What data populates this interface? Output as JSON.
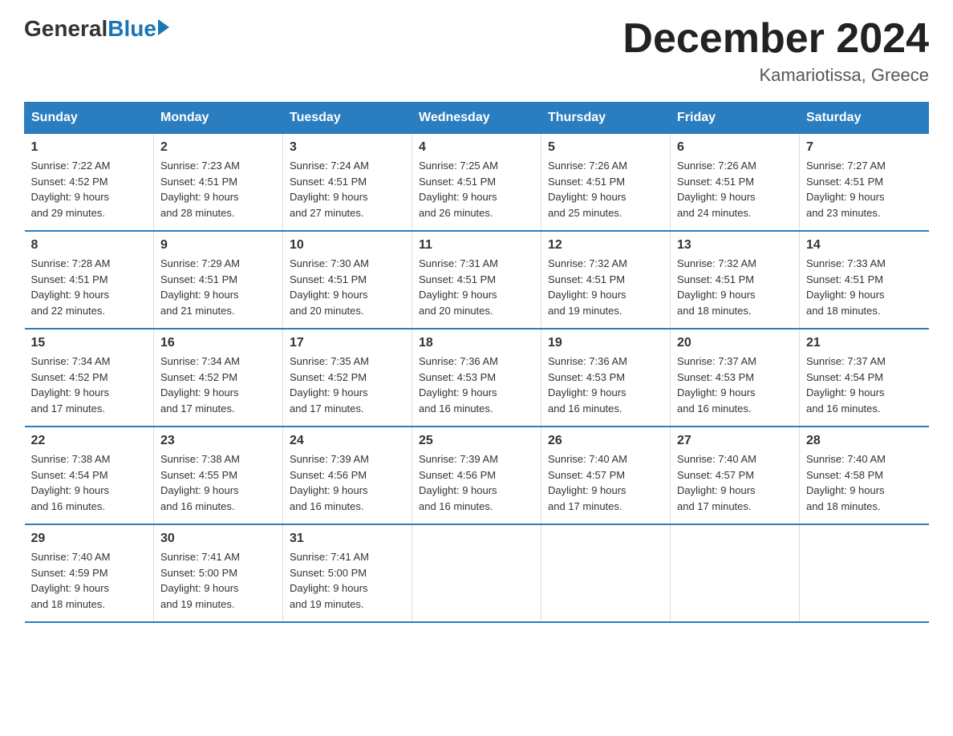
{
  "logo": {
    "general": "General",
    "blue": "Blue"
  },
  "title": "December 2024",
  "location": "Kamariotissa, Greece",
  "days_of_week": [
    "Sunday",
    "Monday",
    "Tuesday",
    "Wednesday",
    "Thursday",
    "Friday",
    "Saturday"
  ],
  "weeks": [
    [
      {
        "day": "1",
        "sunrise": "7:22 AM",
        "sunset": "4:52 PM",
        "daylight": "9 hours and 29 minutes."
      },
      {
        "day": "2",
        "sunrise": "7:23 AM",
        "sunset": "4:51 PM",
        "daylight": "9 hours and 28 minutes."
      },
      {
        "day": "3",
        "sunrise": "7:24 AM",
        "sunset": "4:51 PM",
        "daylight": "9 hours and 27 minutes."
      },
      {
        "day": "4",
        "sunrise": "7:25 AM",
        "sunset": "4:51 PM",
        "daylight": "9 hours and 26 minutes."
      },
      {
        "day": "5",
        "sunrise": "7:26 AM",
        "sunset": "4:51 PM",
        "daylight": "9 hours and 25 minutes."
      },
      {
        "day": "6",
        "sunrise": "7:26 AM",
        "sunset": "4:51 PM",
        "daylight": "9 hours and 24 minutes."
      },
      {
        "day": "7",
        "sunrise": "7:27 AM",
        "sunset": "4:51 PM",
        "daylight": "9 hours and 23 minutes."
      }
    ],
    [
      {
        "day": "8",
        "sunrise": "7:28 AM",
        "sunset": "4:51 PM",
        "daylight": "9 hours and 22 minutes."
      },
      {
        "day": "9",
        "sunrise": "7:29 AM",
        "sunset": "4:51 PM",
        "daylight": "9 hours and 21 minutes."
      },
      {
        "day": "10",
        "sunrise": "7:30 AM",
        "sunset": "4:51 PM",
        "daylight": "9 hours and 20 minutes."
      },
      {
        "day": "11",
        "sunrise": "7:31 AM",
        "sunset": "4:51 PM",
        "daylight": "9 hours and 20 minutes."
      },
      {
        "day": "12",
        "sunrise": "7:32 AM",
        "sunset": "4:51 PM",
        "daylight": "9 hours and 19 minutes."
      },
      {
        "day": "13",
        "sunrise": "7:32 AM",
        "sunset": "4:51 PM",
        "daylight": "9 hours and 18 minutes."
      },
      {
        "day": "14",
        "sunrise": "7:33 AM",
        "sunset": "4:51 PM",
        "daylight": "9 hours and 18 minutes."
      }
    ],
    [
      {
        "day": "15",
        "sunrise": "7:34 AM",
        "sunset": "4:52 PM",
        "daylight": "9 hours and 17 minutes."
      },
      {
        "day": "16",
        "sunrise": "7:34 AM",
        "sunset": "4:52 PM",
        "daylight": "9 hours and 17 minutes."
      },
      {
        "day": "17",
        "sunrise": "7:35 AM",
        "sunset": "4:52 PM",
        "daylight": "9 hours and 17 minutes."
      },
      {
        "day": "18",
        "sunrise": "7:36 AM",
        "sunset": "4:53 PM",
        "daylight": "9 hours and 16 minutes."
      },
      {
        "day": "19",
        "sunrise": "7:36 AM",
        "sunset": "4:53 PM",
        "daylight": "9 hours and 16 minutes."
      },
      {
        "day": "20",
        "sunrise": "7:37 AM",
        "sunset": "4:53 PM",
        "daylight": "9 hours and 16 minutes."
      },
      {
        "day": "21",
        "sunrise": "7:37 AM",
        "sunset": "4:54 PM",
        "daylight": "9 hours and 16 minutes."
      }
    ],
    [
      {
        "day": "22",
        "sunrise": "7:38 AM",
        "sunset": "4:54 PM",
        "daylight": "9 hours and 16 minutes."
      },
      {
        "day": "23",
        "sunrise": "7:38 AM",
        "sunset": "4:55 PM",
        "daylight": "9 hours and 16 minutes."
      },
      {
        "day": "24",
        "sunrise": "7:39 AM",
        "sunset": "4:56 PM",
        "daylight": "9 hours and 16 minutes."
      },
      {
        "day": "25",
        "sunrise": "7:39 AM",
        "sunset": "4:56 PM",
        "daylight": "9 hours and 16 minutes."
      },
      {
        "day": "26",
        "sunrise": "7:40 AM",
        "sunset": "4:57 PM",
        "daylight": "9 hours and 17 minutes."
      },
      {
        "day": "27",
        "sunrise": "7:40 AM",
        "sunset": "4:57 PM",
        "daylight": "9 hours and 17 minutes."
      },
      {
        "day": "28",
        "sunrise": "7:40 AM",
        "sunset": "4:58 PM",
        "daylight": "9 hours and 18 minutes."
      }
    ],
    [
      {
        "day": "29",
        "sunrise": "7:40 AM",
        "sunset": "4:59 PM",
        "daylight": "9 hours and 18 minutes."
      },
      {
        "day": "30",
        "sunrise": "7:41 AM",
        "sunset": "5:00 PM",
        "daylight": "9 hours and 19 minutes."
      },
      {
        "day": "31",
        "sunrise": "7:41 AM",
        "sunset": "5:00 PM",
        "daylight": "9 hours and 19 minutes."
      },
      null,
      null,
      null,
      null
    ]
  ],
  "labels": {
    "sunrise": "Sunrise:",
    "sunset": "Sunset:",
    "daylight": "Daylight:"
  }
}
